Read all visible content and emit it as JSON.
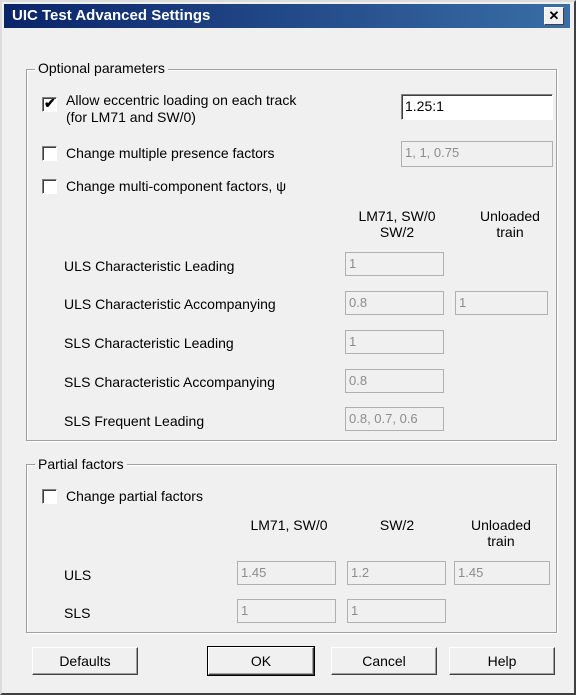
{
  "window": {
    "title": "UIC Test Advanced Settings",
    "close_glyph": "✕"
  },
  "optional": {
    "group_label": "Optional parameters",
    "eccentric": {
      "label_line1": "Allow eccentric loading on each track",
      "label_line2": "(for LM71 and SW/0)",
      "checked": true,
      "check_glyph": "✔",
      "value": "1.25:1"
    },
    "presence": {
      "label": "Change multiple presence factors",
      "checked": false,
      "value": "1, 1, 0.75"
    },
    "multicomp": {
      "label": "Change multi-component factors, ψ",
      "checked": false
    },
    "col_lm71_line1": "LM71,  SW/0",
    "col_lm71_line2": "SW/2",
    "col_unloaded_line1": "Unloaded",
    "col_unloaded_line2": "train",
    "rows": [
      {
        "label": "ULS Characteristic Leading",
        "v1": "1",
        "v2": ""
      },
      {
        "label": "ULS Characteristic Accompanying",
        "v1": "0.8",
        "v2": "1"
      },
      {
        "label": "SLS Characteristic Leading",
        "v1": "1",
        "v2": ""
      },
      {
        "label": "SLS Characteristic Accompanying",
        "v1": "0.8",
        "v2": ""
      },
      {
        "label": "SLS Frequent Leading",
        "v1": "0.8, 0.7, 0.6",
        "v2": ""
      }
    ]
  },
  "partial": {
    "group_label": "Partial factors",
    "change": {
      "label": "Change partial factors",
      "checked": false
    },
    "col_lm71": "LM71,  SW/0",
    "col_sw2": "SW/2",
    "col_unloaded_line1": "Unloaded",
    "col_unloaded_line2": "train",
    "uls": {
      "label": "ULS",
      "v1": "1.45",
      "v2": "1.2",
      "v3": "1.45"
    },
    "sls": {
      "label": "SLS",
      "v1": "1",
      "v2": "1"
    }
  },
  "buttons": {
    "defaults": "Defaults",
    "ok": "OK",
    "cancel": "Cancel",
    "help": "Help"
  }
}
